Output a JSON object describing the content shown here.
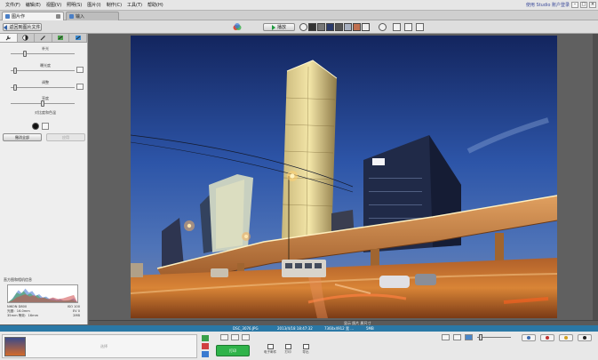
{
  "menubar": {
    "items": [
      "文件(F)",
      "编辑(E)",
      "视图(V)",
      "照明(S)",
      "图片(I)",
      "制作(C)",
      "工具(T)",
      "帮助(H)"
    ],
    "right_link": "使用 Studio 账户登录"
  },
  "tabs": [
    {
      "label": "图片作",
      "active": true
    },
    {
      "label": "输入",
      "active": false
    }
  ],
  "toolbar": {
    "back_label": "返回到图片文件",
    "play_label": "播放"
  },
  "adjust_panel": {
    "sliders": [
      {
        "label": "补光",
        "value": 0.2
      },
      {
        "label": "曝光度",
        "value": 0.05
      },
      {
        "label": "调整",
        "value": 0.05
      },
      {
        "label": "亮度",
        "value": 0.5
      },
      {
        "label": "对比度和色温",
        "value": 0.5
      }
    ],
    "reset_label": "撤消全部",
    "apply_label": "应用"
  },
  "histogram": {
    "title": "直方图和相机信息",
    "camera": "NIKON D800",
    "lens": "f/16.0s",
    "shutter": "1/30 秒",
    "focal": "光圈：16.0mm",
    "iso": "ISO 100",
    "ev": "EV 0",
    "focal2": "35mm 等效：16mm",
    "size": "2MB",
    "res": "JPG ... 3.4"
  },
  "photo_caption": "显示 照片 原尺寸",
  "infobar": {
    "filename": "DSC_3076.JPG",
    "date": "2013/4/18 18:47:32",
    "dimensions": "7360x4912 宽 ...",
    "filesize": "5MB"
  },
  "filmstrip": {
    "label": "选择"
  },
  "bottom_actions": {
    "print_label": "打印",
    "mail_label": "电子邮件",
    "print2_label": "打印",
    "export_label": "导出"
  }
}
